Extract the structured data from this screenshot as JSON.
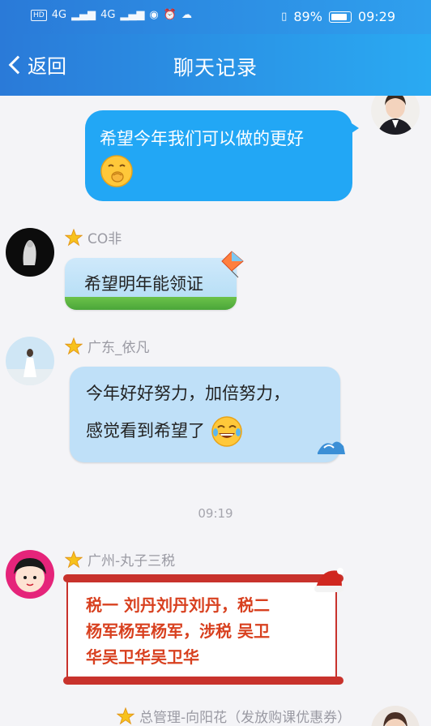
{
  "status_bar": {
    "network1": "4G",
    "network2": "4G",
    "hd": "HD",
    "battery_percent": "89%",
    "time": "09:29"
  },
  "nav": {
    "back_label": "返回",
    "title": "聊天记录"
  },
  "messages": [
    {
      "sender": "",
      "text": "希望今年我们可以做的更好",
      "emoji": "smirk-face-emoji",
      "style": "self"
    },
    {
      "sender": "CO非",
      "text": "希望明年能领证",
      "style": "kite"
    },
    {
      "sender": "广东_依凡",
      "text_line1": "今年好好努力，加倍努力，",
      "text_line2": "感觉看到希望了",
      "emoji": "tears-of-joy-emoji",
      "style": "wave"
    },
    {
      "sender": "广州-丸子三税",
      "text_line1": "税一 刘丹刘丹刘丹，税二",
      "text_line2": "杨军杨军杨军，涉税 吴卫",
      "text_line3": "华吴卫华吴卫华",
      "style": "scroll"
    },
    {
      "sender": "总管理-向阳花（发放购课优惠券）"
    }
  ],
  "time_divider": "09:19",
  "colors": {
    "nav_bg_start": "#2a7ad8",
    "nav_bg_end": "#2aaaf2",
    "self_bubble": "#22a7f5",
    "nick_text": "#9a9aa3",
    "scroll_text": "#d8401f"
  }
}
